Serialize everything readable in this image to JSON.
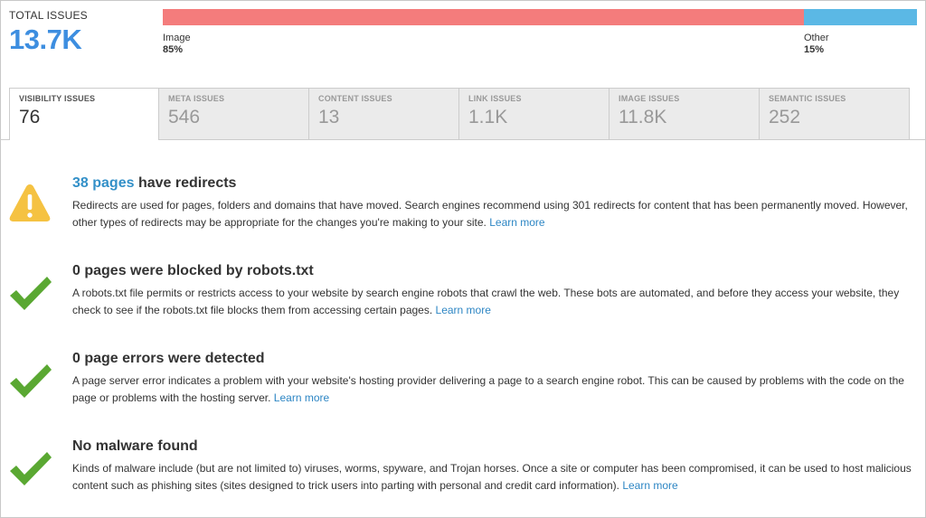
{
  "total": {
    "label": "TOTAL ISSUES",
    "value": "13.7K"
  },
  "breakdown": [
    {
      "name": "Image",
      "percent_label": "85%",
      "fraction": 0.85,
      "color": "#f47c7c"
    },
    {
      "name": "Other",
      "percent_label": "15%",
      "fraction": 0.15,
      "color": "#5bb8e5"
    }
  ],
  "tabs": [
    {
      "label": "VISIBILITY ISSUES",
      "count": "76",
      "active": true
    },
    {
      "label": "META ISSUES",
      "count": "546",
      "active": false
    },
    {
      "label": "CONTENT ISSUES",
      "count": "13",
      "active": false
    },
    {
      "label": "LINK ISSUES",
      "count": "1.1K",
      "active": false
    },
    {
      "label": "IMAGE ISSUES",
      "count": "11.8K",
      "active": false
    },
    {
      "label": "SEMANTIC ISSUES",
      "count": "252",
      "active": false
    }
  ],
  "issues": [
    {
      "icon": "warning-icon",
      "title_highlight": "38 pages",
      "title": "have redirects",
      "description": "Redirects are used for pages, folders and domains that have moved. Search engines recommend using 301 redirects for content that has been permanently moved. However, other types of redirects may be appropriate for the changes you're making to your site.",
      "link": "Learn more"
    },
    {
      "icon": "checkmark-icon",
      "title_highlight": "",
      "title": "0 pages were blocked by robots.txt",
      "description": "A robots.txt file permits or restricts access to your website by search engine robots that crawl the web. These bots are automated, and before they access your website, they check to see if the robots.txt file blocks them from accessing certain pages.",
      "link": "Learn more"
    },
    {
      "icon": "checkmark-icon",
      "title_highlight": "",
      "title": "0 page errors were detected",
      "description": "A page server error indicates a problem with your website's hosting provider delivering a page to a search engine robot. This can be caused by problems with the code on the page or problems with the hosting server.",
      "link": "Learn more"
    },
    {
      "icon": "checkmark-icon",
      "title_highlight": "",
      "title": "No malware found",
      "description": "Kinds of malware include (but are not limited to) viruses, worms, spyware, and Trojan horses. Once a site or computer has been compromised, it can be used to host malicious content such as phishing sites (sites designed to trick users into parting with personal and credit card information).",
      "link": "Learn more"
    }
  ],
  "colors": {
    "accent": "#3d8ee0",
    "link": "#2d86c4",
    "warning": "#f5c242",
    "success": "#5aa832"
  }
}
